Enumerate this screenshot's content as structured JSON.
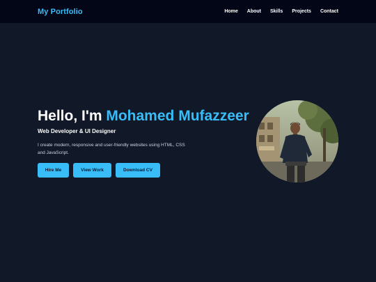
{
  "nav": {
    "brand": "My Portfolio",
    "links": [
      {
        "label": "Home"
      },
      {
        "label": "About"
      },
      {
        "label": "Skills"
      },
      {
        "label": "Projects"
      },
      {
        "label": "Contact"
      }
    ]
  },
  "hero": {
    "greeting": "Hello, I'm ",
    "name": "Mohamed Mufazzeer",
    "subtitle": "Web Developer & UI Designer",
    "description": "I create modern, responsive and user-friendly websites using HTML, CSS and JavaScript.",
    "buttons": {
      "hire": "Hire Me",
      "work": "View Work",
      "cv": "Download CV"
    }
  },
  "colors": {
    "accent": "#38bdf8",
    "navbar_bg": "#020617",
    "hero_bg": "#111827"
  }
}
